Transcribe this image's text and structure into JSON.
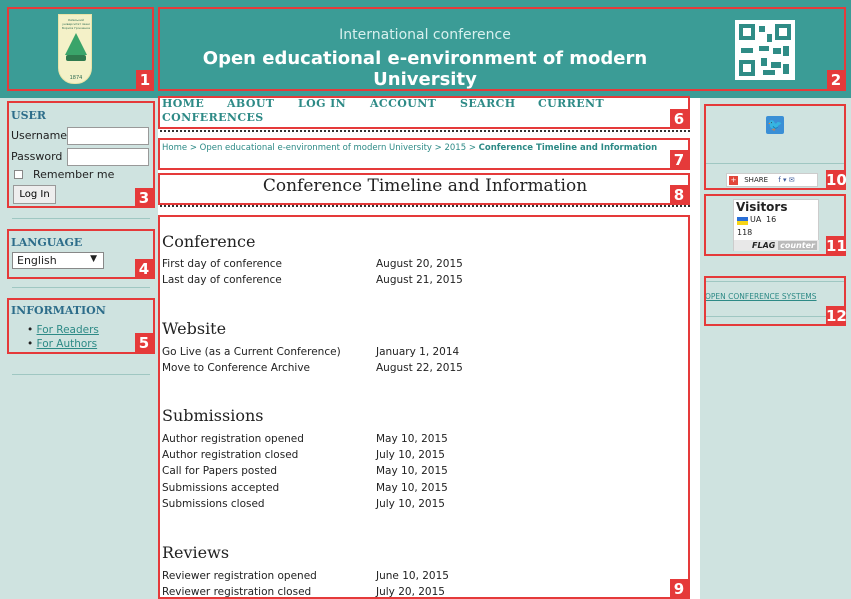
{
  "header": {
    "subtitle": "International conference",
    "title": "Open educational e-environment of modern University",
    "logo": {
      "text": "Київський університет імені Бориса Грінченка",
      "year": "1874"
    }
  },
  "sidebar_left": {
    "user": {
      "title": "USER",
      "username_label": "Username",
      "password_label": "Password",
      "remember_label": "Remember me",
      "login_button": "Log In"
    },
    "language": {
      "title": "LANGUAGE",
      "selected": "English"
    },
    "information": {
      "title": "INFORMATION",
      "links": [
        "For Readers",
        "For Authors"
      ]
    }
  },
  "nav": {
    "items": [
      "HOME",
      "ABOUT",
      "LOG IN",
      "ACCOUNT",
      "SEARCH",
      "CURRENT",
      "CONFERENCES"
    ]
  },
  "breadcrumb": {
    "home": "Home",
    "conference": "Open educational e-environment of modern University",
    "year": "2015",
    "current": "Conference Timeline and Information",
    "sep": ">"
  },
  "page": {
    "title": "Conference Timeline and Information"
  },
  "sections": [
    {
      "title": "Conference",
      "rows": [
        {
          "label": "First day of conference",
          "value": "August 20, 2015"
        },
        {
          "label": "Last day of conference",
          "value": "August 21, 2015"
        }
      ]
    },
    {
      "title": "Website",
      "rows": [
        {
          "label": "Go Live (as a Current Conference)",
          "value": "January 1, 2014"
        },
        {
          "label": "Move to Conference Archive",
          "value": "August 22, 2015"
        }
      ]
    },
    {
      "title": "Submissions",
      "rows": [
        {
          "label": "Author registration opened",
          "value": "May 10, 2015"
        },
        {
          "label": "Author registration closed",
          "value": "July 10, 2015"
        },
        {
          "label": "Call for Papers posted",
          "value": "May 10, 2015"
        },
        {
          "label": "Submissions accepted",
          "value": "May 10, 2015"
        },
        {
          "label": "Submissions closed",
          "value": "July 10, 2015"
        }
      ]
    },
    {
      "title": "Reviews",
      "rows": [
        {
          "label": "Reviewer registration opened",
          "value": "June 10, 2015"
        },
        {
          "label": "Reviewer registration closed",
          "value": "July 20, 2015"
        }
      ]
    }
  ],
  "sidebar_right": {
    "share": {
      "label": "SHARE",
      "icons": "f ▾ ✉"
    },
    "visitors": {
      "title": "Visitors",
      "country": "UA",
      "count_country": "16",
      "total": "118",
      "brand": "FLAG",
      "brand2": "counter"
    },
    "ocs_link": "OPEN CONFERENCE SYSTEMS"
  },
  "annotations": [
    "1",
    "2",
    "3",
    "4",
    "5",
    "6",
    "7",
    "8",
    "9",
    "10",
    "11",
    "12"
  ],
  "colors": {
    "header_bg": "#3b9c96",
    "sidebar_bg": "#cfe3e0",
    "link": "#2d8a86",
    "annotation": "#e53a3a"
  }
}
